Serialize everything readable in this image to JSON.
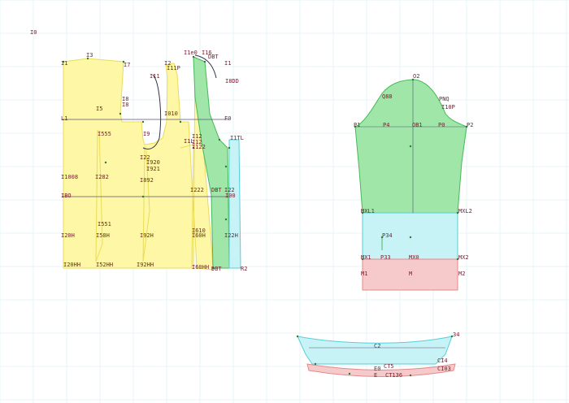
{
  "colors": {
    "grid": "#d6eef2",
    "yellow_fill": "#fdf7a6",
    "yellow_stroke": "#e9dc5a",
    "green_fill": "#9fe6a8",
    "green_stroke": "#47b85a",
    "cyan_fill": "#c8f3f6",
    "cyan_stroke": "#56cfd9",
    "pink_fill": "#f6caca",
    "pink_stroke": "#e38a8a",
    "label": "#7a1c2e",
    "construction_line": "#555577"
  },
  "pieces": {
    "front_back_body": "front-back-body",
    "facing_strip": "facing-strip",
    "sleeve": "sleeve",
    "collar": "collar"
  },
  "labels": {
    "origin": "I0",
    "body_top_left": "I1",
    "body_top": "I3",
    "body_i7": "I7",
    "body_i2": "I2",
    "body_i1": "I1",
    "body_i11p": "I11P",
    "body_i1e0": "I1e0",
    "body_i16": "I16",
    "body_dbt": "DBT",
    "body_i1b": "I1",
    "body_i8d": "I8DD",
    "body_i11": "I11",
    "body_i8": "I8",
    "body_r8": "I8",
    "body_i5": "I5",
    "body_i010": "I010",
    "body_l1": "L1",
    "body_f0": "F0",
    "body_i555": "I555",
    "body_i9": "I9",
    "body_i12": "I12",
    "body_i12b": "I12",
    "body_i122": "I122",
    "body_i1l": "I1L",
    "body_i1tl": "I1TL",
    "body_i22": "I22",
    "body_i920": "I920",
    "body_i921": "I921",
    "body_i008": "I1008",
    "body_i282": "I282",
    "body_i892": "I892",
    "body_i222": "I222",
    "body_dbt2": "DBT",
    "body_i22b": "I22",
    "body_i00": "I00",
    "body_ibo": "IBO",
    "body_i551": "I551",
    "body_i610": "I610",
    "body_i20h": "I20H",
    "body_i58h": "I58H",
    "body_i92h": "I92H",
    "body_i60h": "I60H",
    "body_i22h": "I22H",
    "body_i20hh": "I20HH",
    "body_i52hh": "I52HH",
    "body_i92hh": "I92HH",
    "body_i60hh": "I60HH",
    "body_dbtr": "DBT",
    "body_r02": "R2",
    "sleeve_o2": "O2",
    "sleeve_q88": "Q88",
    "sleeve_pnq": "PNQ",
    "sleeve_i10p": "I10P",
    "sleeve_p1": "P1",
    "sleeve_p4": "P4",
    "sleeve_ob1": "OB1",
    "sleeve_p0": "P0",
    "sleeve_p2": "P2",
    "sleeve_mxl1": "MXL1",
    "sleeve_mxl2": "MXL2",
    "sleeve_p34": "P34",
    "sleeve_mx1": "MX1",
    "sleeve_p33": "P33",
    "sleeve_mx0": "MX0",
    "sleeve_mx2": "MX2",
    "sleeve_m1": "M1",
    "sleeve_m": "M",
    "sleeve_m2": "M2",
    "collar_34": "34",
    "collar_c2": "C2",
    "collar_ci4": "CI4",
    "collar_ct5": "CT5",
    "collar_e0": "E0",
    "collar_ci03": "CI03",
    "collar_e": "E",
    "collar_ct136": "CT136"
  }
}
